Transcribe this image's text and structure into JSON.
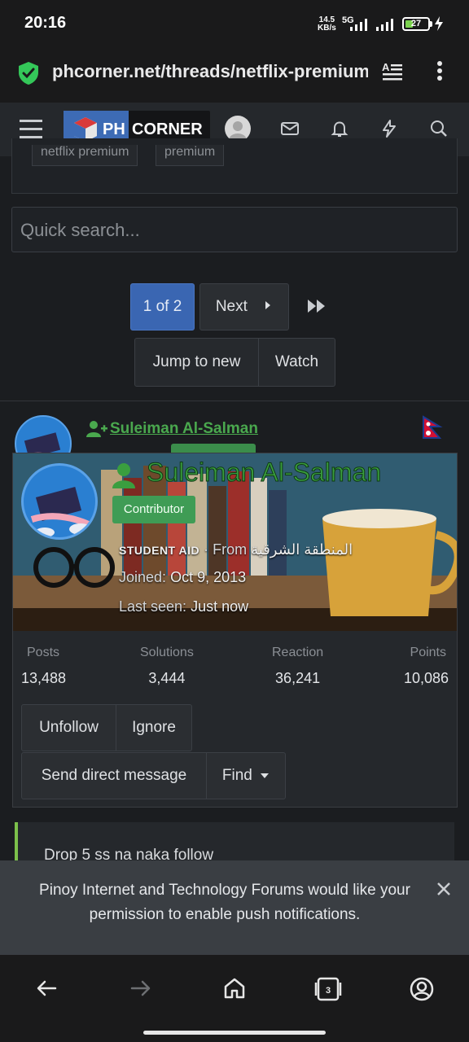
{
  "status_bar": {
    "time": "20:16",
    "net_speed_value": "14.5",
    "net_speed_unit": "KB/s",
    "network_type": "5G",
    "battery": "27",
    "battery_color": "#7bd24f"
  },
  "browser": {
    "url": "phcorner.net/threads/netflix-premium",
    "icons": [
      "shield-check-icon",
      "reader-mode-icon",
      "more-vert-icon"
    ],
    "tab_count": "3"
  },
  "site_header": {
    "logo_left": "PH",
    "logo_right": "CORNER",
    "icons": [
      "hamburger-icon",
      "avatar",
      "mail-icon",
      "bell-icon",
      "bolt-icon",
      "search-icon"
    ]
  },
  "tags": [
    "netflix premium",
    "premium"
  ],
  "search": {
    "placeholder": "Quick search..."
  },
  "pagination": {
    "current": "1 of 2",
    "next": "Next",
    "jump_to_new": "Jump to new",
    "watch": "Watch"
  },
  "post": {
    "username": "Suleiman Al-Salman",
    "flag": "Nepal"
  },
  "member_card": {
    "username": "Suleiman Al-Salman",
    "badge": "Contributor",
    "title": "STUDENT AID",
    "from_label": "· From",
    "location": "المنطقة الشرقية",
    "joined_label": "Joined:",
    "joined_value": "Oct 9, 2013",
    "last_seen_label": "Last seen:",
    "last_seen_value": "Just now",
    "stats": [
      {
        "label": "Posts",
        "value": "13,488"
      },
      {
        "label": "Solutions",
        "value": "3,444"
      },
      {
        "label": "Reaction",
        "value": "36,241"
      },
      {
        "label": "Points",
        "value": "10,086"
      }
    ],
    "actions": {
      "unfollow": "Unfollow",
      "ignore": "Ignore",
      "send_dm": "Send direct message",
      "find": "Find"
    }
  },
  "quote_text": "Drop 5 ss na naka follow",
  "notification_prompt": {
    "text": "Pinoy Internet and Technology Forums would like your permission to enable push notifications."
  },
  "colors": {
    "accent_blue": "#3a66b2",
    "username_green": "#4aa84e",
    "badge_green": "#3f9c55",
    "quote_bar": "#7cc04b"
  }
}
